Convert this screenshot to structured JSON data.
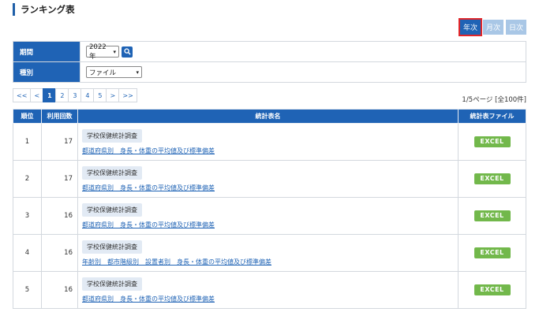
{
  "page_title": "ランキング表",
  "period_tabs": [
    {
      "label": "年次",
      "active": true
    },
    {
      "label": "月次",
      "active": false
    },
    {
      "label": "日次",
      "active": false
    }
  ],
  "filters": {
    "period_label": "期間",
    "period_value": "2022年",
    "type_label": "種別",
    "type_value": "ファイル"
  },
  "pager": [
    "<<",
    "<",
    "1",
    "2",
    "3",
    "4",
    "5",
    ">",
    ">>"
  ],
  "current_page": "1",
  "page_info": "1/5ページ [全100件]",
  "table": {
    "headers": [
      "順位",
      "利用回数",
      "統計表名",
      "統計表ファイル"
    ],
    "rows": [
      {
        "rank": "1",
        "uses": "17",
        "category": "学校保健統計調査",
        "name": "都道府県別　身長・体重の平均値及び標準偏差",
        "file": "EXCEL"
      },
      {
        "rank": "2",
        "uses": "17",
        "category": "学校保健統計調査",
        "name": "都道府県別　身長・体重の平均値及び標準偏差",
        "file": "EXCEL"
      },
      {
        "rank": "3",
        "uses": "16",
        "category": "学校保健統計調査",
        "name": "都道府県別　身長・体重の平均値及び標準偏差",
        "file": "EXCEL"
      },
      {
        "rank": "4",
        "uses": "16",
        "category": "学校保健統計調査",
        "name": "年齢別　都市階級別　設置者別　身長・体重の平均値及び標準偏差",
        "file": "EXCEL"
      },
      {
        "rank": "5",
        "uses": "16",
        "category": "学校保健統計調査",
        "name": "都道府県別　身長・体重の平均値及び標準偏差",
        "file": "EXCEL"
      }
    ]
  },
  "colors": {
    "primary": "#1f63b5",
    "excel": "#72b84b",
    "highlight": "#e0262a"
  },
  "icons": {
    "search": "search-icon",
    "dropdown": "chevron-down-icon"
  }
}
